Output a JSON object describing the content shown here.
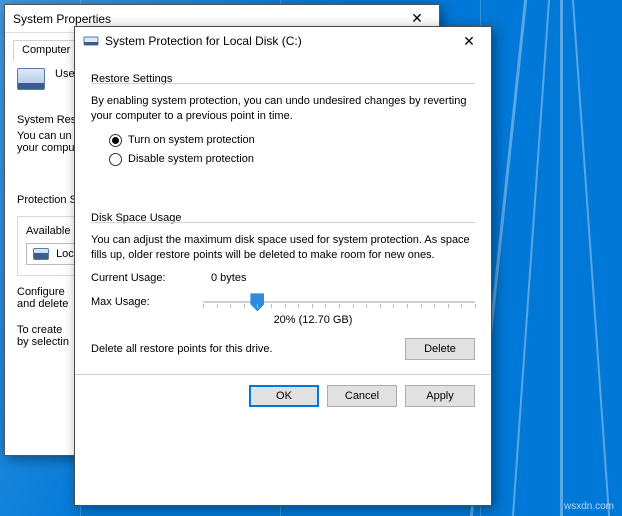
{
  "back_window": {
    "title": "System Properties",
    "tab": "Computer Na",
    "row_label": "Use",
    "sys_restore_heading": "System Res",
    "sys_restore_desc1": "You can un",
    "sys_restore_desc2": "your compu",
    "protection_heading": "Protection S",
    "available_header": "Available",
    "drive_label": "Loca",
    "configure_line1": "Configure",
    "configure_line2": "and delete",
    "create_line1": "To create",
    "create_line2": "by selectin"
  },
  "front_window": {
    "title": "System Protection for Local Disk (C:)",
    "restore": {
      "heading": "Restore Settings",
      "desc": "By enabling system protection, you can undo undesired changes by reverting your computer to a previous point in time.",
      "opt_on": "Turn on system protection",
      "opt_off": "Disable system protection"
    },
    "disk": {
      "heading": "Disk Space Usage",
      "desc": "You can adjust the maximum disk space used for system protection. As space fills up, older restore points will be deleted to make room for new ones.",
      "current_label": "Current Usage:",
      "current_value": "0 bytes",
      "max_label": "Max Usage:",
      "slider_percent": 20,
      "slider_value_text": "20% (12.70 GB)",
      "delete_desc": "Delete all restore points for this drive.",
      "delete_btn": "Delete"
    },
    "buttons": {
      "ok": "OK",
      "cancel": "Cancel",
      "apply": "Apply"
    }
  }
}
